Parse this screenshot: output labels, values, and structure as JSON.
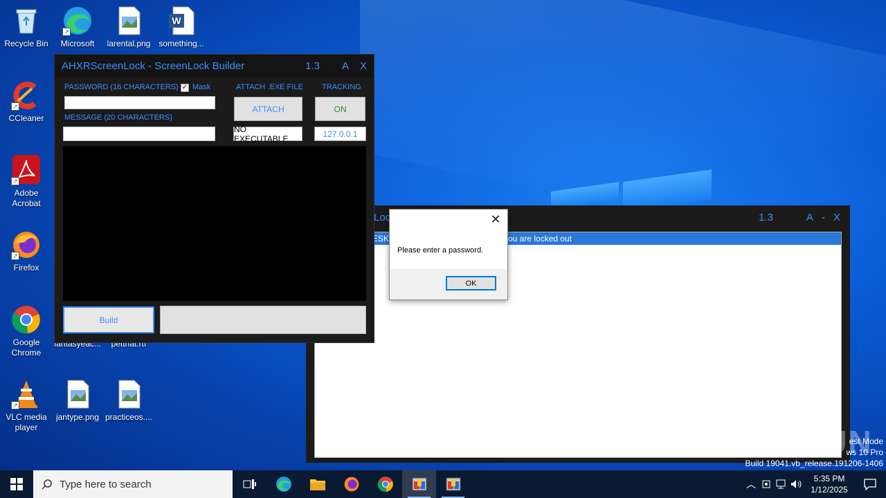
{
  "desktop": {
    "icons": [
      {
        "label": "Recycle Bin",
        "icon": "recycle-bin-icon"
      },
      {
        "label": "Microsoft Edge",
        "icon": "edge-icon"
      },
      {
        "label": "larental.png",
        "icon": "image-file-icon"
      },
      {
        "label": "something...",
        "icon": "word-doc-icon"
      },
      {
        "label": "CCleaner",
        "icon": "ccleaner-icon"
      },
      {
        "label": "Adobe Acrobat",
        "icon": "acrobat-icon"
      },
      {
        "label": "Firefox",
        "icon": "firefox-icon"
      },
      {
        "label": "Google Chrome",
        "icon": "chrome-icon"
      },
      {
        "label": "fantasyeac...",
        "icon": "file-icon"
      },
      {
        "label": "pettnat.rtf",
        "icon": "file-icon"
      },
      {
        "label": "VLC media player",
        "icon": "vlc-icon"
      },
      {
        "label": "jantype.png",
        "icon": "image-file-icon"
      },
      {
        "label": "practiceos....",
        "icon": "image-file-icon"
      }
    ]
  },
  "builder": {
    "title": "AHXRScreenLock - ScreenLock Builder",
    "version": "1.3",
    "btn_a": "A",
    "btn_x": "X",
    "password_label": "PASSWORD (16 CHARACTERS)",
    "mask_label": "Mask",
    "mask_checked": "✓",
    "message_label": "MESSAGE (20 CHARACTERS)",
    "attach_label": "ATTACH .EXE FILE",
    "attach_button": "ATTACH",
    "attach_value": "NO EXECUTABLE",
    "tracking_label": "TRACKING",
    "tracking_button": "ON",
    "tracking_value": "127.0.0.1",
    "build_button": "Build"
  },
  "locker": {
    "title_fragment": "Loc",
    "version": "1.3",
    "btn_a": "A",
    "btn_min": "-",
    "btn_x": "X",
    "line_left": "ESKT",
    "line_right": "ou are locked out"
  },
  "dialog": {
    "message": "Please enter a password.",
    "ok_button": "OK",
    "close_glyph": "✕"
  },
  "taskbar": {
    "search_placeholder": "Type here to search",
    "time": "5:35 PM",
    "date": "1/12/2025"
  },
  "watermark": {
    "line1": "est Mode",
    "line2": "ws 10 Pro",
    "line3": "Build 19041.vb_release.191206-1406",
    "brand": "ANY RUN"
  },
  "colors": {
    "accent": "#3d8eff",
    "window_bg": "#1b1b1b",
    "taskbar_bg": "#0b1a33",
    "selection": "#2a78d8"
  }
}
